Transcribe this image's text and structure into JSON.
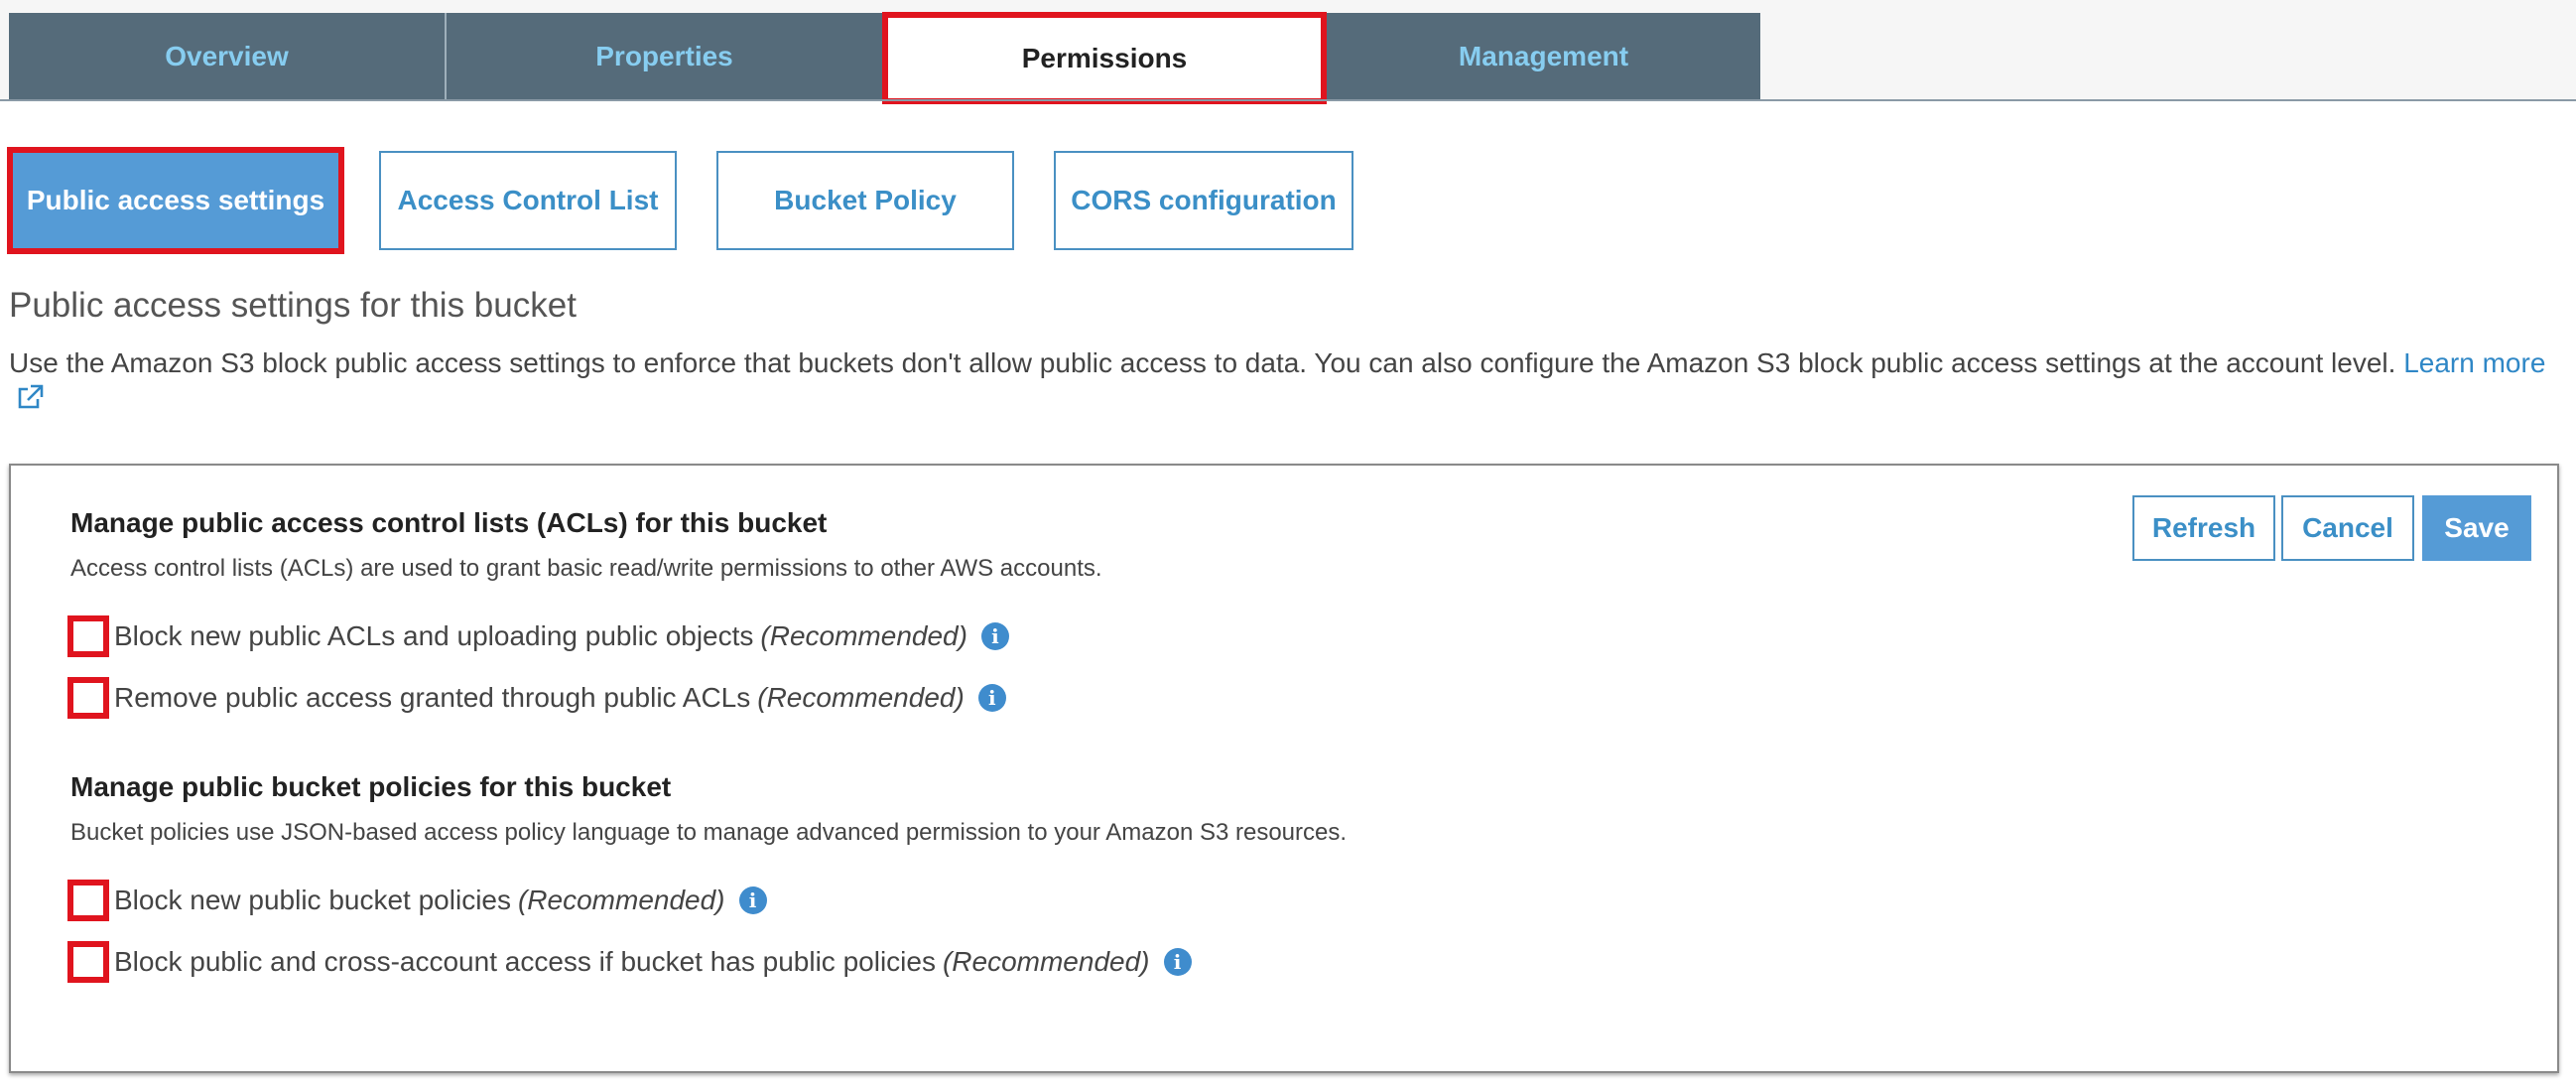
{
  "tabs": [
    {
      "label": "Overview",
      "active": false
    },
    {
      "label": "Properties",
      "active": false
    },
    {
      "label": "Permissions",
      "active": true
    },
    {
      "label": "Management",
      "active": false
    }
  ],
  "subtabs": [
    {
      "label": "Public access settings",
      "active": true
    },
    {
      "label": "Access Control List",
      "active": false
    },
    {
      "label": "Bucket Policy",
      "active": false
    },
    {
      "label": "CORS configuration",
      "active": false
    }
  ],
  "page": {
    "title": "Public access settings for this bucket",
    "description": "Use the Amazon S3 block public access settings to enforce that buckets don't allow public access to data. You can also configure the Amazon S3 block public access settings at the account level.",
    "learn_more": "Learn more"
  },
  "actions": {
    "refresh": "Refresh",
    "cancel": "Cancel",
    "save": "Save"
  },
  "acl_group": {
    "title": "Manage public access control lists (ACLs) for this bucket",
    "description": "Access control lists (ACLs) are used to grant basic read/write permissions to other AWS accounts.",
    "options": [
      {
        "label": "Block new public ACLs and uploading public objects",
        "note": "(Recommended)",
        "checked": false
      },
      {
        "label": "Remove public access granted through public ACLs",
        "note": "(Recommended)",
        "checked": false
      }
    ]
  },
  "policy_group": {
    "title": "Manage public bucket policies for this bucket",
    "description": "Bucket policies use JSON-based access policy language to manage advanced permission to your Amazon S3 resources.",
    "options": [
      {
        "label": "Block new public bucket policies",
        "note": "(Recommended)",
        "checked": false
      },
      {
        "label": "Block public and cross-account access if bucket has public policies",
        "note": "(Recommended)",
        "checked": false
      }
    ]
  },
  "icons": {
    "info": "info-icon",
    "external": "external-link-icon"
  },
  "colors": {
    "accent": "#559bd6",
    "highlight": "#e0141e",
    "tab_bg": "#556b7a",
    "tab_text": "#87cdf0",
    "link": "#2f87c6"
  }
}
